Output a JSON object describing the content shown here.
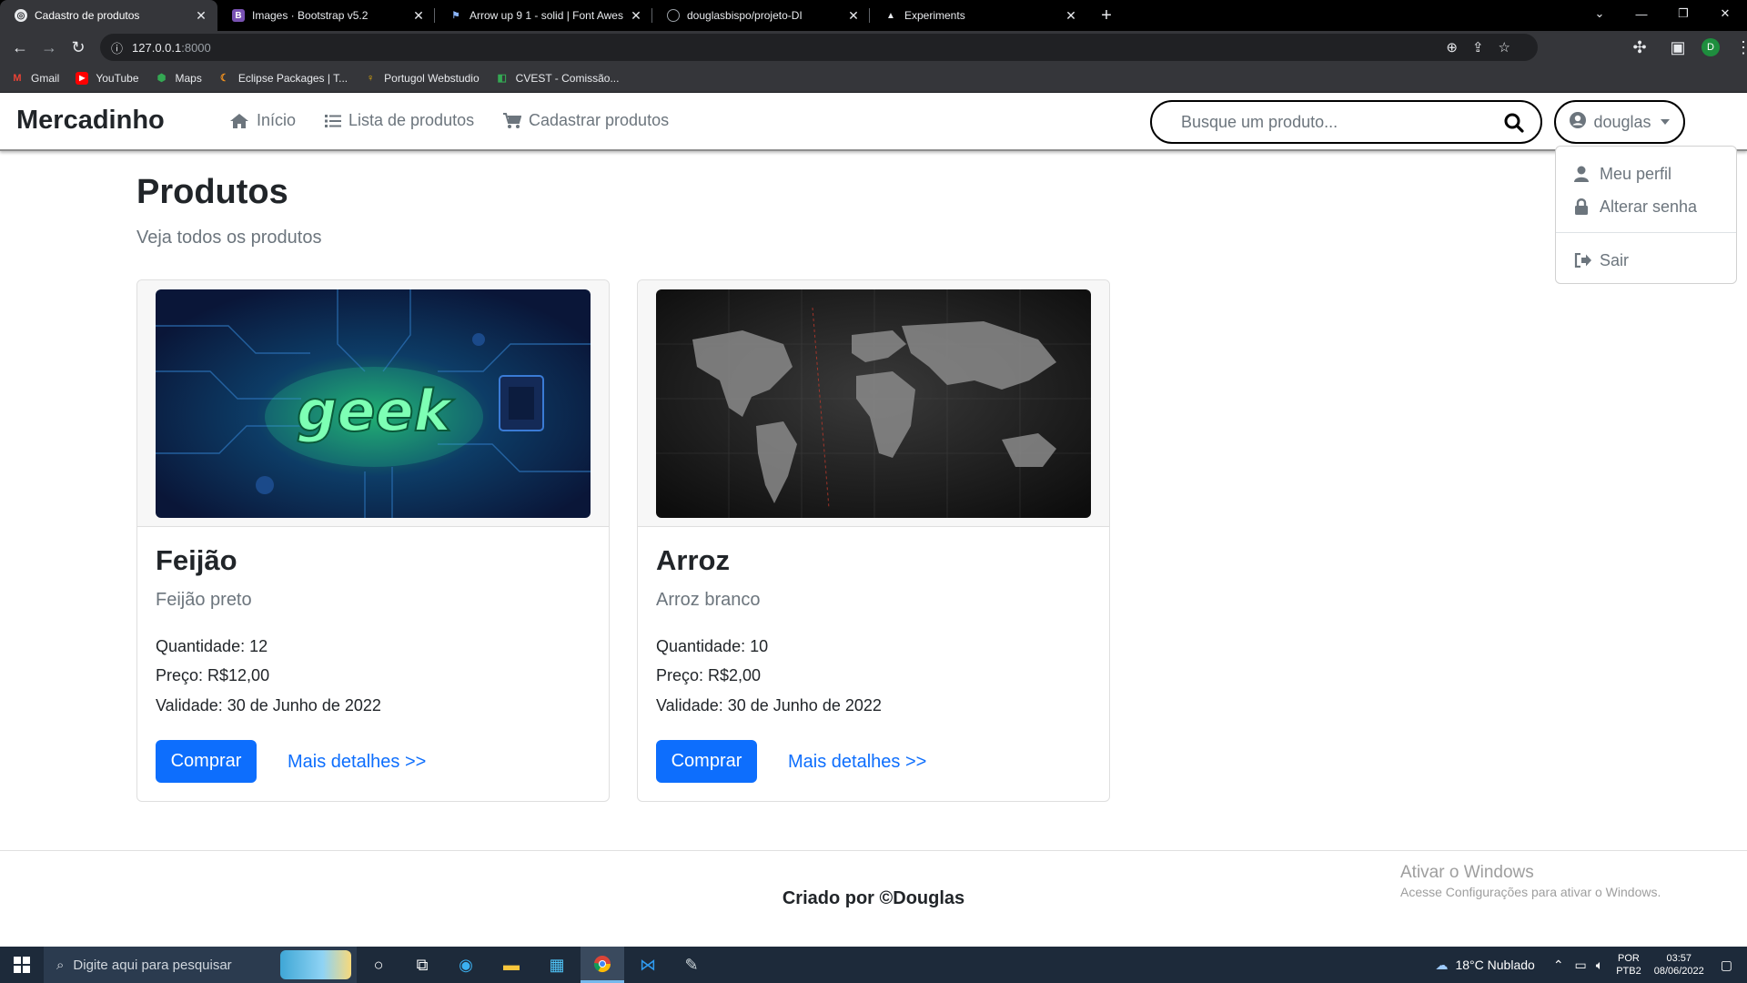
{
  "browser": {
    "tabs": [
      {
        "title": "Cadastro de produtos",
        "active": true,
        "favicon": "globe-icon"
      },
      {
        "title": "Images · Bootstrap v5.2",
        "active": false,
        "favicon": "bootstrap-icon"
      },
      {
        "title": "Arrow up 9 1 - solid | Font Awes",
        "active": false,
        "favicon": "flag-icon"
      },
      {
        "title": "douglasbispo/projeto-DI",
        "active": false,
        "favicon": "github-icon"
      },
      {
        "title": "Experiments",
        "active": false,
        "favicon": "flask-icon"
      }
    ],
    "url_host": "127.0.0.1",
    "url_port": ":8000",
    "profile_initial": "D",
    "bookmarks": [
      {
        "label": "Gmail",
        "icon": "gmail-icon"
      },
      {
        "label": "YouTube",
        "icon": "youtube-icon"
      },
      {
        "label": "Maps",
        "icon": "maps-icon"
      },
      {
        "label": "Eclipse Packages | T...",
        "icon": "eclipse-icon"
      },
      {
        "label": "Portugol Webstudio",
        "icon": "bulb-icon"
      },
      {
        "label": "CVEST - Comissão...",
        "icon": "cvest-icon"
      }
    ]
  },
  "navbar": {
    "brand": "Mercadinho",
    "links": [
      {
        "label": "Início",
        "icon": "home-icon"
      },
      {
        "label": "Lista de produtos",
        "icon": "list-icon"
      },
      {
        "label": "Cadastrar produtos",
        "icon": "cart-icon"
      }
    ],
    "search_placeholder": "Busque um produto...",
    "username": "douglas"
  },
  "user_menu": {
    "items": [
      {
        "label": "Meu perfil",
        "icon": "user-icon"
      },
      {
        "label": "Alterar senha",
        "icon": "lock-icon"
      },
      {
        "label": "Sair",
        "icon": "sign-out-icon"
      }
    ]
  },
  "page": {
    "title": "Produtos",
    "subtitle": "Veja todos os produtos"
  },
  "products": [
    {
      "name": "Feijão",
      "description": "Feijão preto",
      "quantity": "Quantidade: 12",
      "price": "Preço: R$12,00",
      "validity": "Validade: 30 de Junho de 2022",
      "buy_label": "Comprar",
      "details_label": "Mais detalhes >>",
      "image": "geek-circuit-board-image",
      "image_text": "geek"
    },
    {
      "name": "Arroz",
      "description": "Arroz branco",
      "quantity": "Quantidade: 10",
      "price": "Preço: R$2,00",
      "validity": "Validade: 30 de Junho de 2022",
      "buy_label": "Comprar",
      "details_label": "Mais detalhes >>",
      "image": "dark-world-map-image"
    }
  ],
  "footer": {
    "text": "Criado por ©Douglas"
  },
  "watermark": {
    "line1": "Ativar o Windows",
    "line2": "Acesse Configurações para ativar o Windows."
  },
  "taskbar": {
    "search_placeholder": "Digite aqui para pesquisar",
    "weather": "18°C  Nublado",
    "language": "POR",
    "layout": "PTB2",
    "time": "03:57",
    "date": "08/06/2022"
  },
  "colors": {
    "primary": "#0d6efd",
    "muted": "#6c757d",
    "text": "#212529"
  }
}
